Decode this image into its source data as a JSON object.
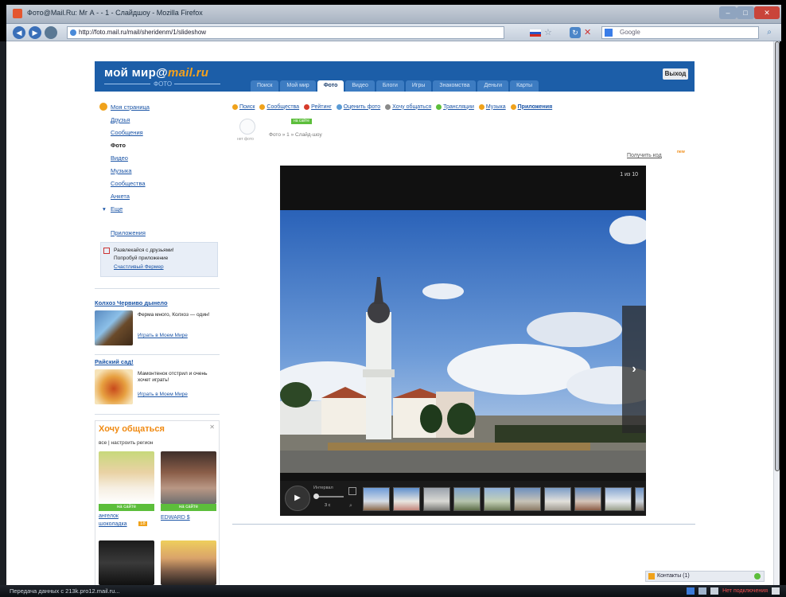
{
  "window": {
    "title": "Фото@Mail.Ru: Мг А - - 1 - Слайдшоу - Mozilla Firefox",
    "controls": {
      "minimize": "–",
      "maximize": "□",
      "close": "✕"
    }
  },
  "browser": {
    "url": "http://foto.mail.ru/mail/sheridenm/1/slideshow",
    "search_placeholder": "Google",
    "back_icon": "◀",
    "forward_icon": "▶"
  },
  "site": {
    "logo": "мой мир",
    "logo_domain": "mail.ru",
    "logo_sub": "ФОТО",
    "exit_button": "Выход",
    "tabs": [
      "Поиск",
      "Мой мир",
      "Фото",
      "Видео",
      "Блоги",
      "Игры",
      "Знакомства",
      "Деньги",
      "Карты"
    ],
    "active_tab": "Фото"
  },
  "sidebar": {
    "items": [
      "Моя страница",
      "Друзья",
      "Сообщения",
      "Фото",
      "Видео",
      "Музыка",
      "Сообщества",
      "Анкета",
      "Еще"
    ],
    "current": "Фото",
    "apps_link": "Приложения",
    "promo": {
      "line1": "Развлекайся с друзьями!",
      "line2": "Попробуй приложение",
      "link": "Счастливый Фермер"
    }
  },
  "games": [
    {
      "title": "Колхоз Червиво дынело",
      "desc": "Ферма много, Колхоз — один!",
      "link": "Играть в Моем Мире"
    },
    {
      "title": "Райский сад!",
      "desc": "Мамонтенок отстрил и очень хочет играть!",
      "link": "Играть в Моем Мире"
    }
  ],
  "chat": {
    "title": "Хочу общаться",
    "subtitle": "все | настроить регион",
    "close": "✕",
    "online_label": "на сайте",
    "people": [
      {
        "name": "ангелок",
        "name2": "шоколадка",
        "badge": "18"
      },
      {
        "name": "EDWARD $",
        "name2": "",
        "badge": ""
      }
    ]
  },
  "topmenu": [
    {
      "label": "Поиск",
      "color": "#f0a21b"
    },
    {
      "label": "Сообщества",
      "color": "#f0a21b"
    },
    {
      "label": "Рейтинг",
      "color": "#d63b2a"
    },
    {
      "label": "Оценить фото",
      "color": "#5a9bd5"
    },
    {
      "label": "Хочу общаться",
      "color": "#8a8a8a"
    },
    {
      "label": "Трансляции",
      "color": "#5cbe3b"
    },
    {
      "label": "Музыка",
      "color": "#f0a21b"
    },
    {
      "label": "Приложения",
      "color": "#f0a21b"
    }
  ],
  "profile": {
    "no_photo": "нет фото",
    "online_badge": "на сайте",
    "breadcrumb": "Фото » 1 » Слайд-шоу"
  },
  "viewer": {
    "get_code": "Получить код",
    "new_tag": "new",
    "counter": "1 из 10",
    "next_icon": "›",
    "play_icon": "▶",
    "interval_label": "Интервал",
    "speed": "3 с",
    "thumbnail_count": 9
  },
  "contacts_bar": {
    "label": "Контакты (1)"
  },
  "statusbar": {
    "text": "Передача данных с 213k.pro12.mail.ru...",
    "tray_text": "Нет подключения"
  }
}
